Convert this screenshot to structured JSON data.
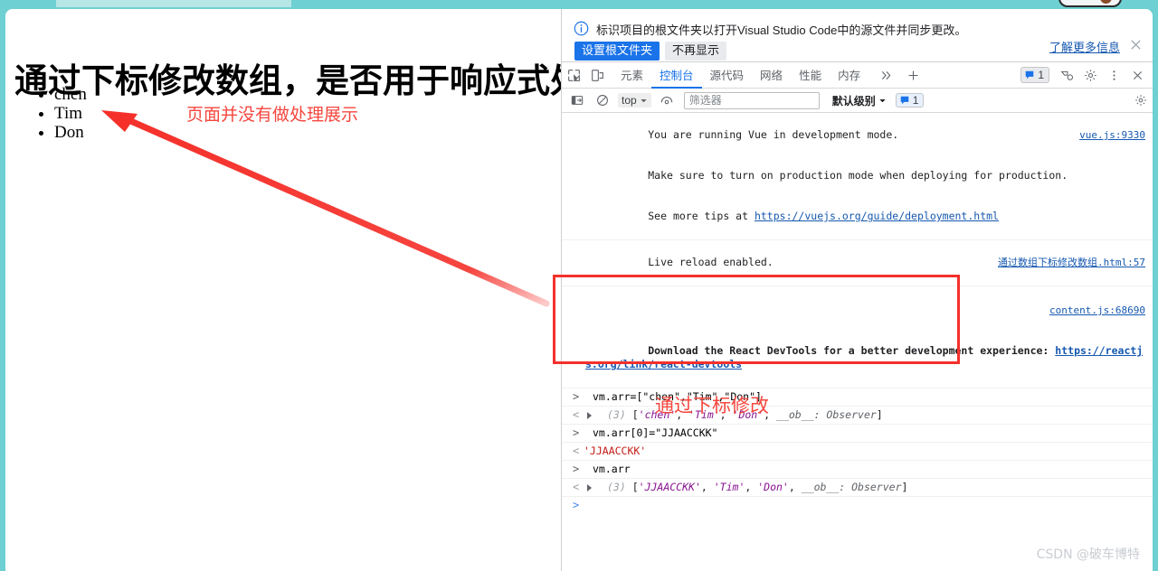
{
  "browser": {
    "chrome_color": "#6ed0d2",
    "tab_stub_color": "#b6e6e6"
  },
  "web_page": {
    "title": "通过下标修改数组，是否用于响应式处理",
    "list_items": [
      "chen",
      "Tim",
      "Don"
    ]
  },
  "annotations": {
    "page_note": "页面并没有做处理展示",
    "console_note": "通过下标修改",
    "color": "#f5473f",
    "box_color": "#f5302a"
  },
  "devtools": {
    "infobar": {
      "icon": "info-icon",
      "message": "标识项目的根文件夹以打开Visual Studio Code中的源文件并同步更改。",
      "primary_button": "设置根文件夹",
      "secondary_button": "不再显示",
      "learn_more": "了解更多信息",
      "close_icon": "close-icon"
    },
    "tabbar": {
      "inspect_icon": "inspect-element-icon",
      "device_icon": "device-toolbar-icon",
      "tabs": [
        {
          "label": "元素",
          "active": false
        },
        {
          "label": "控制台",
          "active": true
        },
        {
          "label": "源代码",
          "active": false
        },
        {
          "label": "网络",
          "active": false
        },
        {
          "label": "性能",
          "active": false
        },
        {
          "label": "内存",
          "active": false
        }
      ],
      "more_tabs_icon": "chevron-double-right-icon",
      "add_tab_icon": "plus-icon",
      "issues_count": "1",
      "issues_icon": "issue-bubble-icon",
      "vue_icon": "vue-devtools-icon",
      "settings_icon": "gear-icon",
      "more_icon": "kebab-menu-icon",
      "close_icon": "close-icon"
    },
    "console_toolbar": {
      "sidebar_icon": "console-sidebar-icon",
      "clear_icon": "clear-console-icon",
      "context": "top",
      "context_caret": "chevron-down-icon",
      "eye_icon": "live-expression-icon",
      "filter_value": "",
      "filter_placeholder": "筛选器",
      "level": "默认级别",
      "level_caret": "chevron-down-icon",
      "issues_count": "1",
      "issues_icon": "issue-bubble-icon",
      "settings_icon": "gear-icon"
    },
    "messages": [
      {
        "type": "log",
        "source": "vue.js:9330",
        "lines": [
          "You are running Vue in development mode.",
          "Make sure to turn on production mode when deploying for production.",
          "See more tips at "
        ],
        "link": "https://vuejs.org/guide/deployment.html"
      },
      {
        "type": "log",
        "source": "通过数组下标修改数组.html:57",
        "lines": [
          "Live reload enabled."
        ]
      },
      {
        "type": "log",
        "source": "content.js:68690",
        "lines": [
          "Download the React DevTools for a better development experience: "
        ],
        "link": "https://reactjs.org/link/react-devtools"
      }
    ],
    "console_entries": [
      {
        "input": "vm.arr=[\"chen\",\"Tim\",\"Don\"]",
        "output_count": "(3)",
        "output_values": [
          "'chen'",
          "'Tim'",
          "'Don'"
        ],
        "output_suffix": "__ob__: Observer",
        "highlighted": false
      },
      {
        "input": "vm.arr[0]=\"JJAACCKK\"",
        "output_plain": "'JJAACCKK'",
        "highlighted": true
      },
      {
        "input": "vm.arr",
        "output_count": "(3)",
        "output_values": [
          "'JJAACCKK'",
          "'Tim'",
          "'Don'"
        ],
        "output_suffix": "__ob__: Observer",
        "highlighted": true
      }
    ],
    "prompt_marker": ">"
  },
  "watermark": "CSDN @破车博特"
}
